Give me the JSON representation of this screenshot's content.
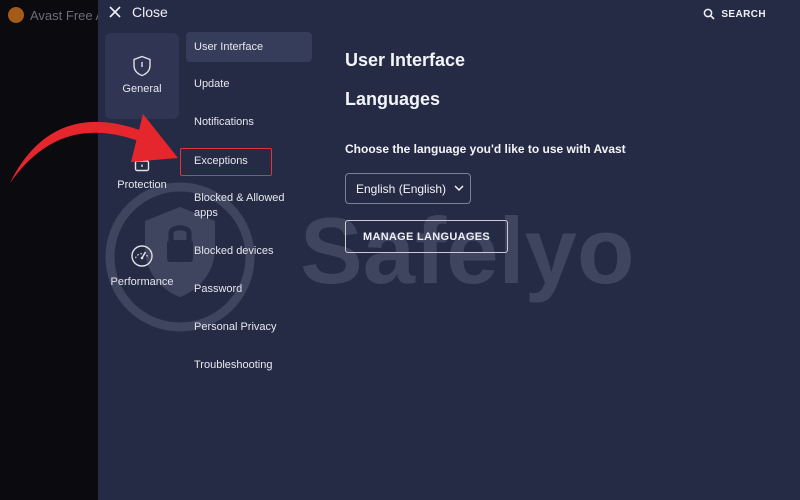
{
  "backdrop": {
    "app_title": "Avast Free A"
  },
  "header": {
    "close_label": "Close",
    "search_label": "SEARCH"
  },
  "categories": [
    {
      "label": "General",
      "icon": "shield-icon",
      "active": true
    },
    {
      "label": "Protection",
      "icon": "lock-icon",
      "active": false
    },
    {
      "label": "Performance",
      "icon": "speedometer-icon",
      "active": false
    }
  ],
  "submenu": [
    {
      "label": "User Interface"
    },
    {
      "label": "Update"
    },
    {
      "label": "Notifications"
    },
    {
      "label": "Exceptions"
    },
    {
      "label": "Blocked & Allowed apps"
    },
    {
      "label": "Blocked devices"
    },
    {
      "label": "Password"
    },
    {
      "label": "Personal Privacy"
    },
    {
      "label": "Troubleshooting"
    }
  ],
  "content": {
    "title": "User Interface",
    "section_title": "Languages",
    "language_prompt": "Choose the language you'd like to use with Avast",
    "language_selected": "English (English)",
    "manage_button": "MANAGE LANGUAGES"
  },
  "watermark": {
    "text": "Safelyo"
  },
  "colors": {
    "panel": "#252b45",
    "highlight_border": "#e0343a",
    "arrow": "#e5262c"
  }
}
